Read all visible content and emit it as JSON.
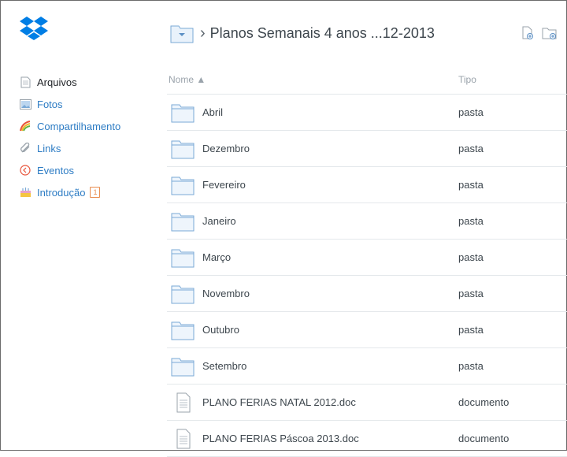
{
  "brand": {
    "accent": "#007ee5",
    "link": "#2d7cc4"
  },
  "sidebar": {
    "items": [
      {
        "label": "Arquivos",
        "icon": "file-icon",
        "active": true
      },
      {
        "label": "Fotos",
        "icon": "photo-icon"
      },
      {
        "label": "Compartilhamento",
        "icon": "rainbow-icon"
      },
      {
        "label": "Links",
        "icon": "link-icon"
      },
      {
        "label": "Eventos",
        "icon": "clock-icon"
      },
      {
        "label": "Introdução",
        "icon": "cake-icon",
        "badge": "1"
      }
    ]
  },
  "header": {
    "separator": "›",
    "title": "Planos Semanais 4 anos ...12-2013"
  },
  "table": {
    "columns": {
      "name": "Nome ▲",
      "type": "Tipo"
    },
    "rows": [
      {
        "name": "Abril",
        "type": "pasta",
        "icon": "folder-icon"
      },
      {
        "name": "Dezembro",
        "type": "pasta",
        "icon": "folder-icon"
      },
      {
        "name": "Fevereiro",
        "type": "pasta",
        "icon": "folder-icon"
      },
      {
        "name": "Janeiro",
        "type": "pasta",
        "icon": "folder-icon"
      },
      {
        "name": "Março",
        "type": "pasta",
        "icon": "folder-icon"
      },
      {
        "name": "Novembro",
        "type": "pasta",
        "icon": "folder-icon"
      },
      {
        "name": "Outubro",
        "type": "pasta",
        "icon": "folder-icon"
      },
      {
        "name": "Setembro",
        "type": "pasta",
        "icon": "folder-icon"
      },
      {
        "name": "PLANO FERIAS NATAL 2012.doc",
        "type": "documento",
        "icon": "document-icon"
      },
      {
        "name": "PLANO FERIAS Páscoa 2013.doc",
        "type": "documento",
        "icon": "document-icon"
      }
    ]
  }
}
